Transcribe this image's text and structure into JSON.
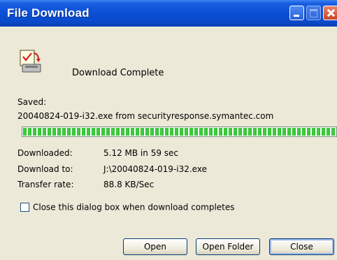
{
  "window": {
    "title": "File Download"
  },
  "titlebar_buttons": {
    "minimize": "minimize-icon",
    "maximize": "maximize-icon",
    "close": "close-icon"
  },
  "status": {
    "text": "Download Complete",
    "icon": "download-complete-icon"
  },
  "saved": {
    "label": "Saved:",
    "file_line": "20040824-019-i32.exe from securityresponse.symantec.com"
  },
  "progress": {
    "percent": 100,
    "color": "#2ebd2e"
  },
  "details": [
    {
      "label": "Downloaded:",
      "value": "5.12 MB in 59 sec"
    },
    {
      "label": "Download to:",
      "value": "J:\\20040824-019-i32.exe"
    },
    {
      "label": "Transfer rate:",
      "value": "88.8 KB/Sec"
    }
  ],
  "close_when_complete": {
    "label": "Close this dialog box when download completes",
    "checked": false
  },
  "buttons": {
    "open": "Open",
    "open_folder": "Open Folder",
    "close": "Close"
  },
  "colors": {
    "titlebar": "#0a4fd6",
    "dialog_bg": "#ece9d8"
  }
}
